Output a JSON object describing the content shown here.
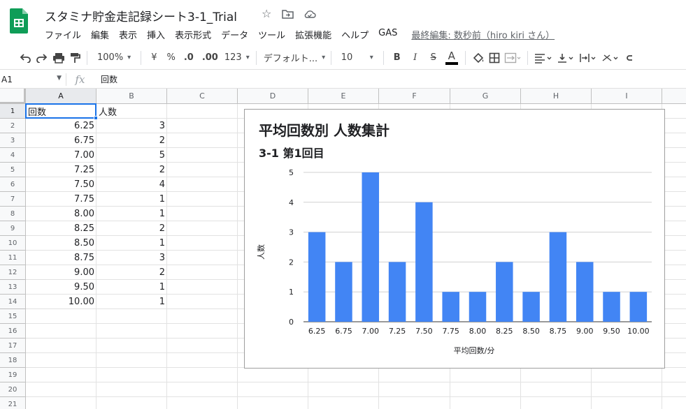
{
  "header": {
    "title": "スタミナ貯金走記録シート3-1_Trial",
    "menu": [
      "ファイル",
      "編集",
      "表示",
      "挿入",
      "表示形式",
      "データ",
      "ツール",
      "拡張機能",
      "ヘルプ",
      "GAS"
    ],
    "last_edit": "最終編集: 数秒前（hiro kiri さん）"
  },
  "toolbar": {
    "zoom": "100%",
    "currency": "¥",
    "percent": "%",
    "decimal_decrease": ".0",
    "decimal_increase": ".00",
    "number_format": "123",
    "font": "デフォルト...",
    "font_size": "10",
    "bold": "B",
    "italic": "I",
    "strike": "S",
    "text_color": "A"
  },
  "formula_bar": {
    "cell_ref": "A1",
    "fx": "fx",
    "content": "回数"
  },
  "columns": [
    "A",
    "B",
    "C",
    "D",
    "E",
    "F",
    "G",
    "H",
    "I"
  ],
  "rows": [
    "1",
    "2",
    "3",
    "4",
    "5",
    "6",
    "7",
    "8",
    "9",
    "10",
    "11",
    "12",
    "13",
    "14",
    "15",
    "16",
    "17",
    "18",
    "19",
    "20",
    "21"
  ],
  "sheet": {
    "header_a": "回数",
    "header_b": "人数",
    "data": [
      [
        "6.25",
        "3"
      ],
      [
        "6.75",
        "2"
      ],
      [
        "7.00",
        "5"
      ],
      [
        "7.25",
        "2"
      ],
      [
        "7.50",
        "4"
      ],
      [
        "7.75",
        "1"
      ],
      [
        "8.00",
        "1"
      ],
      [
        "8.25",
        "2"
      ],
      [
        "8.50",
        "1"
      ],
      [
        "8.75",
        "3"
      ],
      [
        "9.00",
        "2"
      ],
      [
        "9.50",
        "1"
      ],
      [
        "10.00",
        "1"
      ]
    ]
  },
  "colors": {
    "bar": "#4285f4",
    "selection": "#1a73e8",
    "logo": "#0f9d58"
  },
  "chart_data": {
    "type": "bar",
    "title": "平均回数別 人数集計",
    "subtitle": "3-1 第1回目",
    "xlabel": "平均回数/分",
    "ylabel": "人数",
    "categories": [
      "6.25",
      "6.75",
      "7.00",
      "7.25",
      "7.50",
      "7.75",
      "8.00",
      "8.25",
      "8.50",
      "8.75",
      "9.00",
      "9.50",
      "10.00"
    ],
    "values": [
      3,
      2,
      5,
      2,
      4,
      1,
      1,
      2,
      1,
      3,
      2,
      1,
      1
    ],
    "ylim": [
      0,
      5
    ],
    "yticks": [
      "0",
      "1",
      "2",
      "3",
      "4",
      "5"
    ],
    "grid": true,
    "legend": "none"
  }
}
